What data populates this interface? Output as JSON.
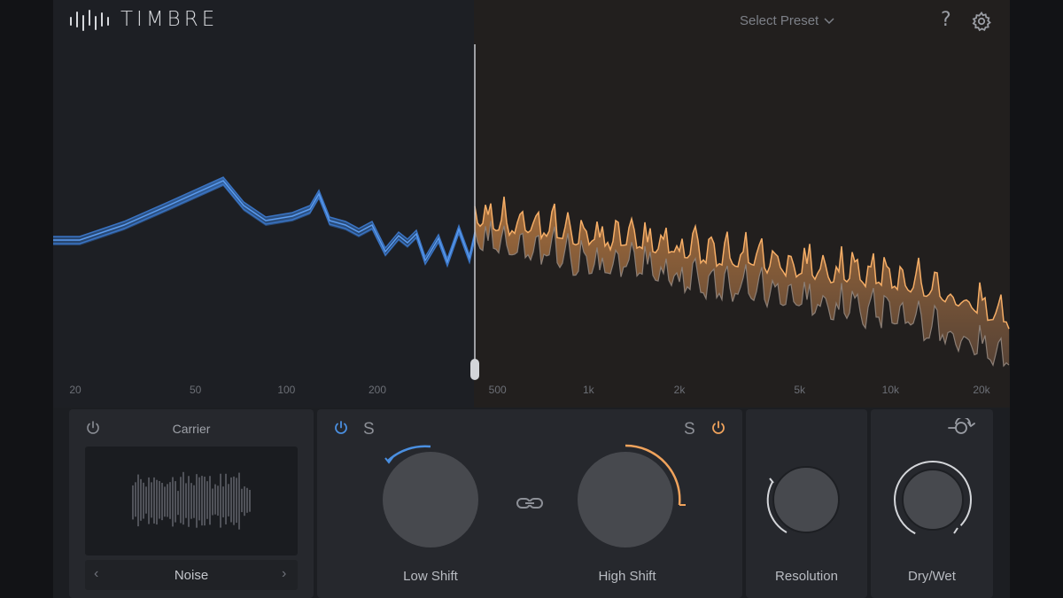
{
  "app": {
    "title": "TIMBRE"
  },
  "header": {
    "preset_label": "Select Preset",
    "help_label": "?"
  },
  "spectrum": {
    "freq_labels": [
      "20",
      "50",
      "100",
      "200",
      "500",
      "1k",
      "2k",
      "5k",
      "10k",
      "20k"
    ],
    "low_color": "#4a8fe0",
    "high_color": "#f0a35c"
  },
  "carrier": {
    "title": "Carrier",
    "value": "Noise"
  },
  "shift": {
    "low_solo": "S",
    "high_solo": "S",
    "low_label": "Low Shift",
    "high_label": "High Shift"
  },
  "resolution": {
    "label": "Resolution"
  },
  "drywet": {
    "label": "Dry/Wet"
  },
  "colors": {
    "accent_blue": "#4a8fe0",
    "accent_orange": "#f0a35c"
  }
}
